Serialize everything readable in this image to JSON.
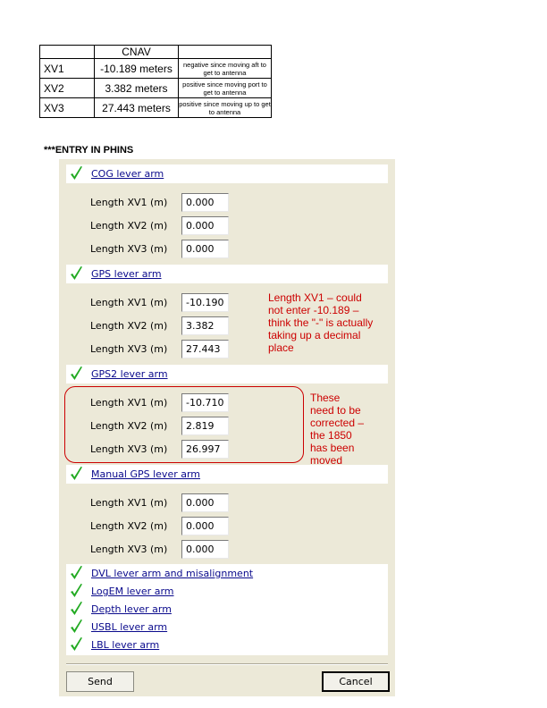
{
  "cnav_table": {
    "header": [
      "",
      "CNAV",
      ""
    ],
    "rows": [
      {
        "axis": "XV1",
        "value": "-10.189 meters",
        "note": "negative since moving aft to get to antenna"
      },
      {
        "axis": "XV2",
        "value": "3.382 meters",
        "note": "positive since moving port to get to antenna"
      },
      {
        "axis": "XV3",
        "value": "27.443 meters",
        "note": "positive since moving up to get to antenna"
      }
    ]
  },
  "entry_heading": "***ENTRY IN PHINS",
  "sections": [
    {
      "title": "COG lever arm",
      "fields": [
        {
          "label": "Length XV1 (m)",
          "value": "0.000"
        },
        {
          "label": "Length XV2 (m)",
          "value": "0.000"
        },
        {
          "label": "Length XV3 (m)",
          "value": "0.000"
        }
      ]
    },
    {
      "title": "GPS lever arm",
      "fields": [
        {
          "label": "Length XV1 (m)",
          "value": "-10.190"
        },
        {
          "label": "Length XV2 (m)",
          "value": "3.382"
        },
        {
          "label": "Length XV3 (m)",
          "value": "27.443"
        }
      ]
    },
    {
      "title": "GPS2 lever arm",
      "fields": [
        {
          "label": "Length XV1 (m)",
          "value": "-10.710"
        },
        {
          "label": "Length XV2 (m)",
          "value": "2.819"
        },
        {
          "label": "Length XV3 (m)",
          "value": "26.997"
        }
      ]
    },
    {
      "title": "Manual GPS lever arm",
      "fields": [
        {
          "label": "Length XV1 (m)",
          "value": "0.000"
        },
        {
          "label": "Length XV2 (m)",
          "value": "0.000"
        },
        {
          "label": "Length XV3 (m)",
          "value": "0.000"
        }
      ]
    }
  ],
  "collapsed_sections": [
    "DVL lever arm and misalignment",
    "LogEM lever arm",
    "Depth lever arm",
    "USBL lever arm",
    "LBL lever arm"
  ],
  "buttons": {
    "send": "Send",
    "cancel": "Cancel"
  },
  "annotations": {
    "gps_note": [
      "Length XV1 – could",
      "not enter -10.189 –",
      "think the \"-\" is actually",
      "taking up a decimal",
      "place"
    ],
    "gps2_note": [
      "These",
      "need to be",
      "corrected –",
      "the 1850",
      "has been",
      "moved"
    ]
  },
  "colors": {
    "check": "#22aa22",
    "link": "#0a0a8c",
    "annotation": "#cc0000",
    "panel": "#ece9d8"
  }
}
